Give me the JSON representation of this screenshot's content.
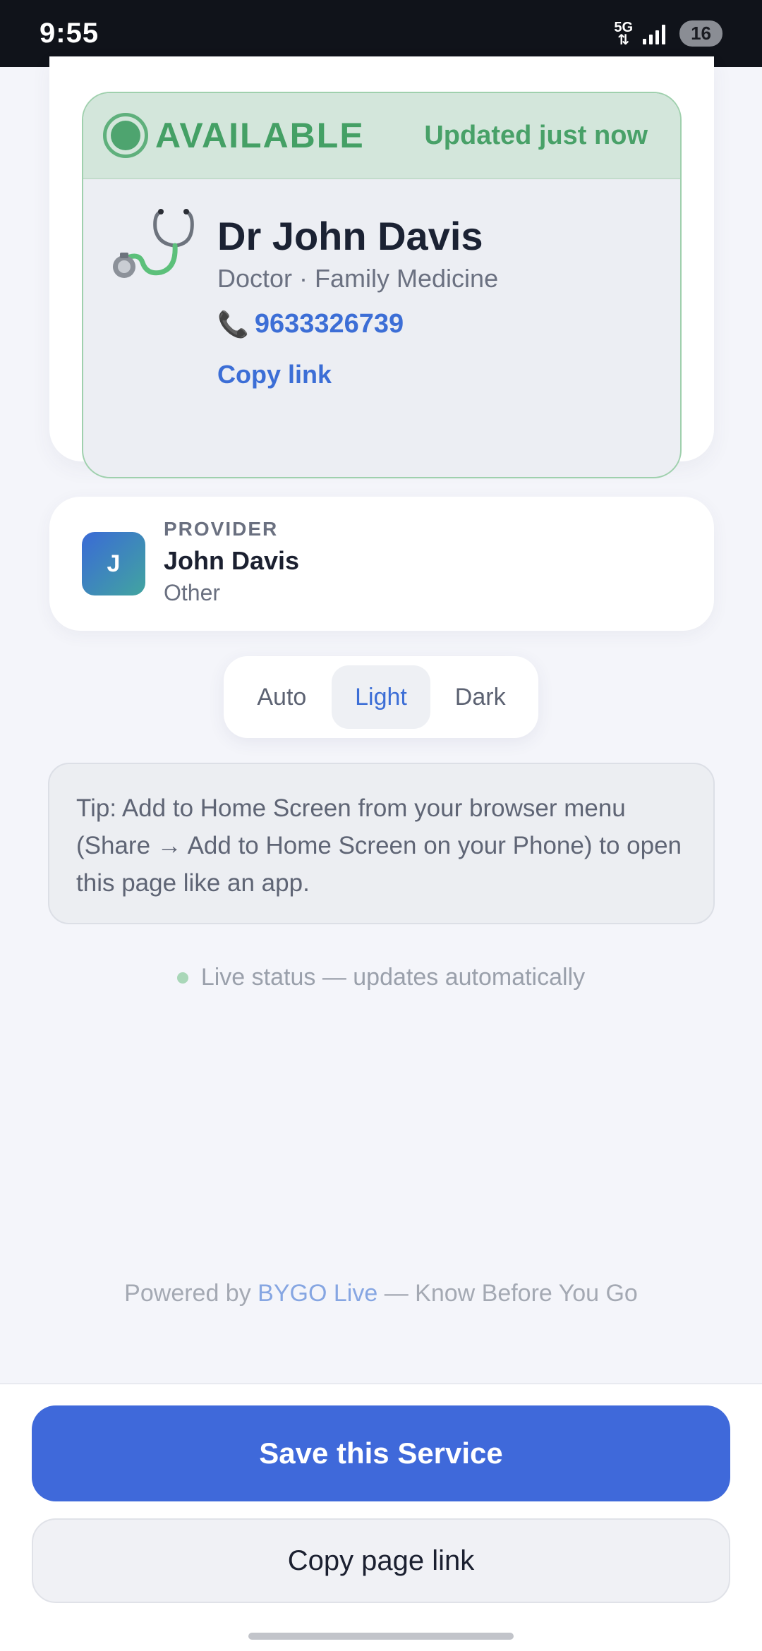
{
  "status_bar": {
    "time": "9:55",
    "network": "5G",
    "battery": "16"
  },
  "availability": {
    "status": "AVAILABLE",
    "updated": "Updated just now"
  },
  "doctor": {
    "icon": "stethoscope-icon",
    "name": "Dr John Davis",
    "subtitle": "Doctor · Family Medicine",
    "phone_icon": "phone-icon",
    "phone": "9633326739",
    "copy_link": "Copy link"
  },
  "provider": {
    "label": "PROVIDER",
    "initial": "J",
    "name": "John Davis",
    "type": "Other"
  },
  "theme": {
    "options": [
      "Auto",
      "Light",
      "Dark"
    ],
    "selected": "Light"
  },
  "tip": "Tip: Add to Home Screen from your browser menu (Share → Add to Home Screen on your Phone) to open this page like an app.",
  "live_status": "Live status — updates automatically",
  "footer": {
    "powered_prefix": "Powered by",
    "brand": "BYGO Live",
    "powered_suffix": "— Know Before You Go"
  },
  "actions": {
    "save": "Save this Service",
    "copy_page": "Copy page link"
  },
  "colors": {
    "accent": "#3f69da",
    "available_green": "#44a065",
    "available_bg": "#d3e6db"
  }
}
